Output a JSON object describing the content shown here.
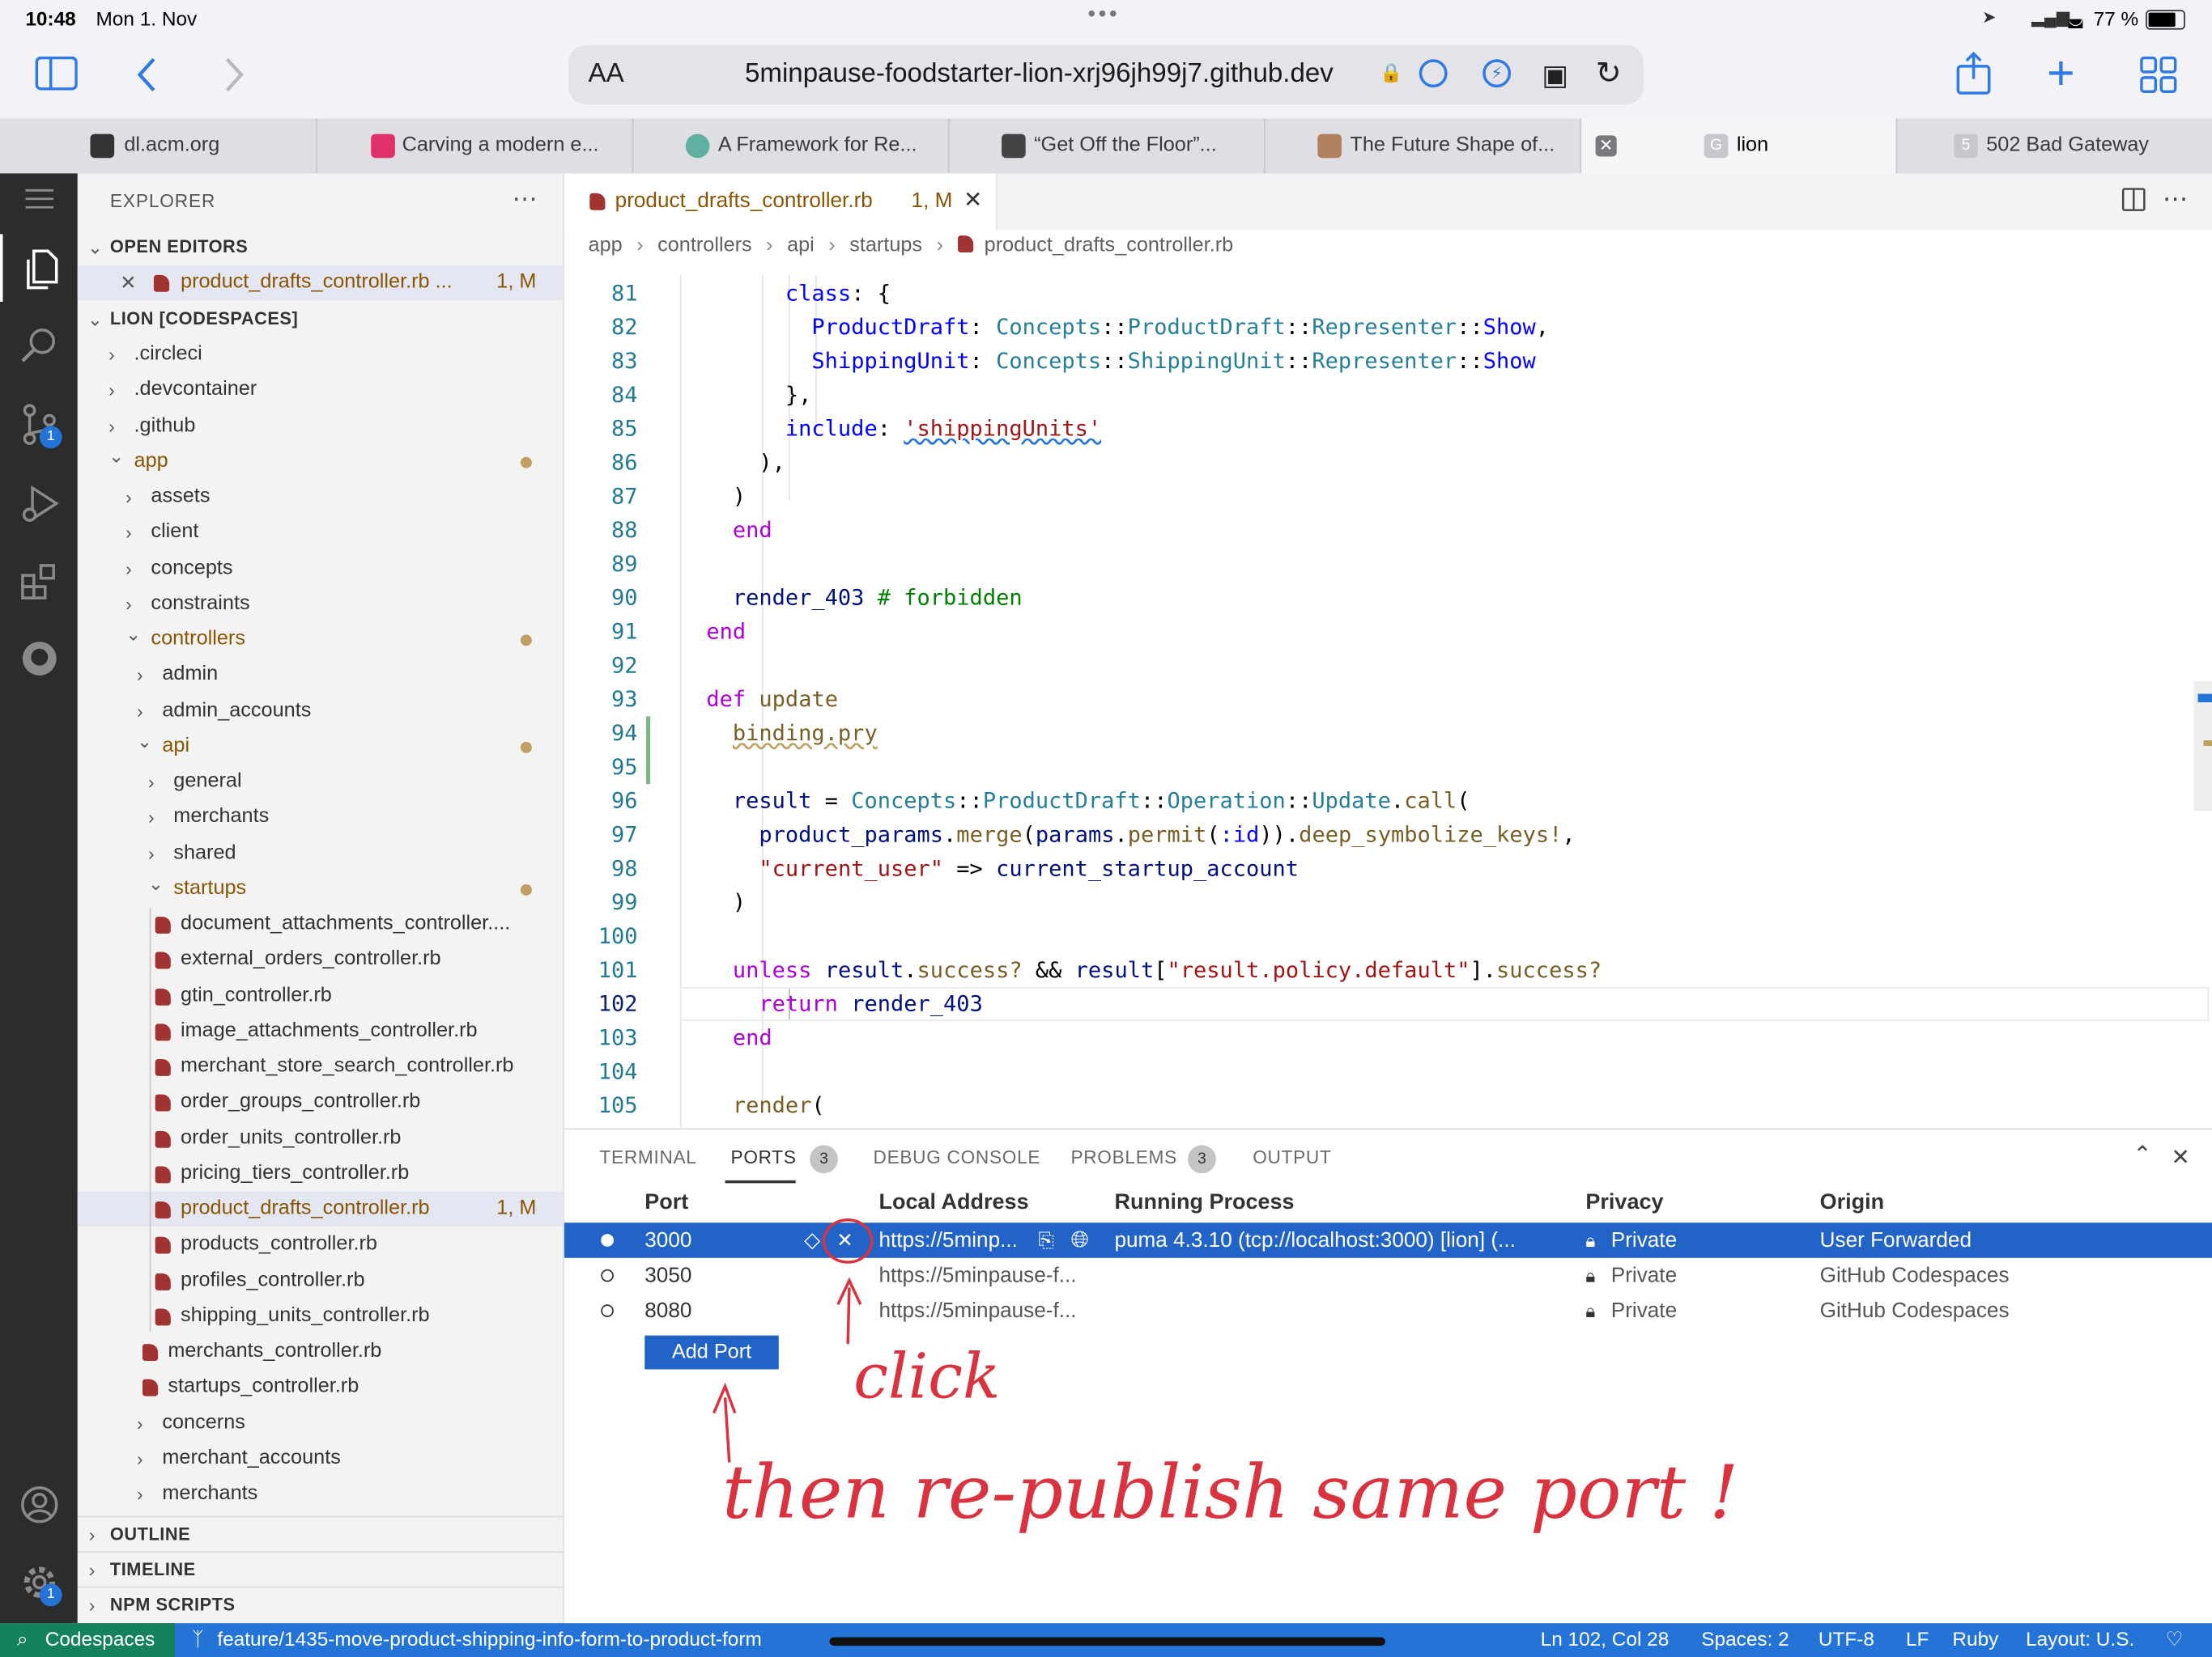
{
  "status_bar": {
    "time": "10:48",
    "date": "Mon 1. Nov",
    "battery": "77 %"
  },
  "browser": {
    "text_size_label": "AA",
    "url": "5minpause-foodstarter-lion-xrj96jh99j7.github.dev",
    "tabs": [
      {
        "label": "dl.acm.org",
        "favicon_color": "#333333"
      },
      {
        "label": "Carving a modern e...",
        "favicon_color": "#e0306a"
      },
      {
        "label": "A Framework for Re...",
        "favicon_color": "#5fb0a0"
      },
      {
        "label": "“Get Off the Floor”...",
        "favicon_color": "#444444"
      },
      {
        "label": "The Future Shape of...",
        "favicon_color": "#b08060"
      },
      {
        "label": "lion",
        "favicon_color": "#c8c8cc",
        "favicon_letter": "G"
      },
      {
        "label": "502 Bad Gateway",
        "favicon_color": "#c8c8cc",
        "favicon_letter": "5"
      }
    ]
  },
  "activity_bar": {
    "scm_badge": "1",
    "settings_badge": "1"
  },
  "sidebar": {
    "title": "EXPLORER",
    "more": "⋯",
    "open_editors_label": "OPEN EDITORS",
    "open_editor_file": "product_drafts_controller.rb ...",
    "open_editor_status": "1, M",
    "workspace_label": "LION [CODESPACES]",
    "tree": [
      {
        "label": ".circleci",
        "chev": ">"
      },
      {
        "label": ".devcontainer",
        "chev": ">"
      },
      {
        "label": ".github",
        "chev": ">"
      },
      {
        "label": "app",
        "chev": "v",
        "modified": true
      },
      {
        "label": "assets",
        "chev": ">"
      },
      {
        "label": "client",
        "chev": ">"
      },
      {
        "label": "concepts",
        "chev": ">"
      },
      {
        "label": "constraints",
        "chev": ">"
      },
      {
        "label": "controllers",
        "chev": "v",
        "modified": true
      },
      {
        "label": "admin",
        "chev": ">"
      },
      {
        "label": "admin_accounts",
        "chev": ">"
      },
      {
        "label": "api",
        "chev": "v",
        "modified": true
      },
      {
        "label": "general",
        "chev": ">"
      },
      {
        "label": "merchants",
        "chev": ">"
      },
      {
        "label": "shared",
        "chev": ">"
      },
      {
        "label": "startups",
        "chev": "v",
        "modified": true
      },
      {
        "label": "document_attachments_controller...."
      },
      {
        "label": "external_orders_controller.rb"
      },
      {
        "label": "gtin_controller.rb"
      },
      {
        "label": "image_attachments_controller.rb"
      },
      {
        "label": "merchant_store_search_controller.rb"
      },
      {
        "label": "order_groups_controller.rb"
      },
      {
        "label": "order_units_controller.rb"
      },
      {
        "label": "pricing_tiers_controller.rb"
      },
      {
        "label": "product_drafts_controller.rb",
        "status": "1, M"
      },
      {
        "label": "products_controller.rb"
      },
      {
        "label": "profiles_controller.rb"
      },
      {
        "label": "shipping_units_controller.rb"
      },
      {
        "label": "merchants_controller.rb"
      },
      {
        "label": "startups_controller.rb"
      },
      {
        "label": "concerns",
        "chev": ">"
      },
      {
        "label": "merchant_accounts",
        "chev": ">"
      },
      {
        "label": "merchants",
        "chev": ">"
      }
    ],
    "outline_label": "OUTLINE",
    "timeline_label": "TIMELINE",
    "npm_label": "NPM SCRIPTS"
  },
  "editor": {
    "tab_label": "product_drafts_controller.rb",
    "tab_status": "1, M",
    "breadcrumb": [
      "app",
      "controllers",
      "api",
      "startups",
      "product_drafts_controller.rb"
    ],
    "line_numbers": [
      "81",
      "82",
      "83",
      "84",
      "85",
      "86",
      "87",
      "88",
      "89",
      "90",
      "91",
      "92",
      "93",
      "94",
      "95",
      "96",
      "97",
      "98",
      "99",
      "100",
      "101",
      "102",
      "103",
      "104",
      "105"
    ],
    "active_line": "102"
  },
  "panel": {
    "tabs": [
      "TERMINAL",
      "PORTS",
      "DEBUG CONSOLE",
      "PROBLEMS",
      "OUTPUT"
    ],
    "ports_count": "3",
    "problems_count": "3",
    "columns": [
      "Port",
      "Local Address",
      "Running Process",
      "Privacy",
      "Origin"
    ],
    "rows": [
      {
        "port": "3000",
        "address": "https://5minp...",
        "process": "puma 4.3.10 (tcp://localhost:3000) [lion] (...",
        "privacy": "Private",
        "origin": "User Forwarded"
      },
      {
        "port": "3050",
        "address": "https://5minpause-f...",
        "process": "",
        "privacy": "Private",
        "origin": "GitHub Codespaces"
      },
      {
        "port": "8080",
        "address": "https://5minpause-f...",
        "process": "",
        "privacy": "Private",
        "origin": "GitHub Codespaces"
      }
    ],
    "add_port_label": "Add Port"
  },
  "annotations": {
    "click": "click",
    "then": "then re-publish same port !"
  },
  "status": {
    "remote": "Codespaces",
    "branch": "feature/1435-move-product-shipping-info-form-to-product-form",
    "position": "Ln 102, Col 28",
    "spaces": "Spaces: 2",
    "encoding": "UTF-8",
    "eol": "LF",
    "language": "Ruby",
    "layout": "Layout: U.S."
  }
}
